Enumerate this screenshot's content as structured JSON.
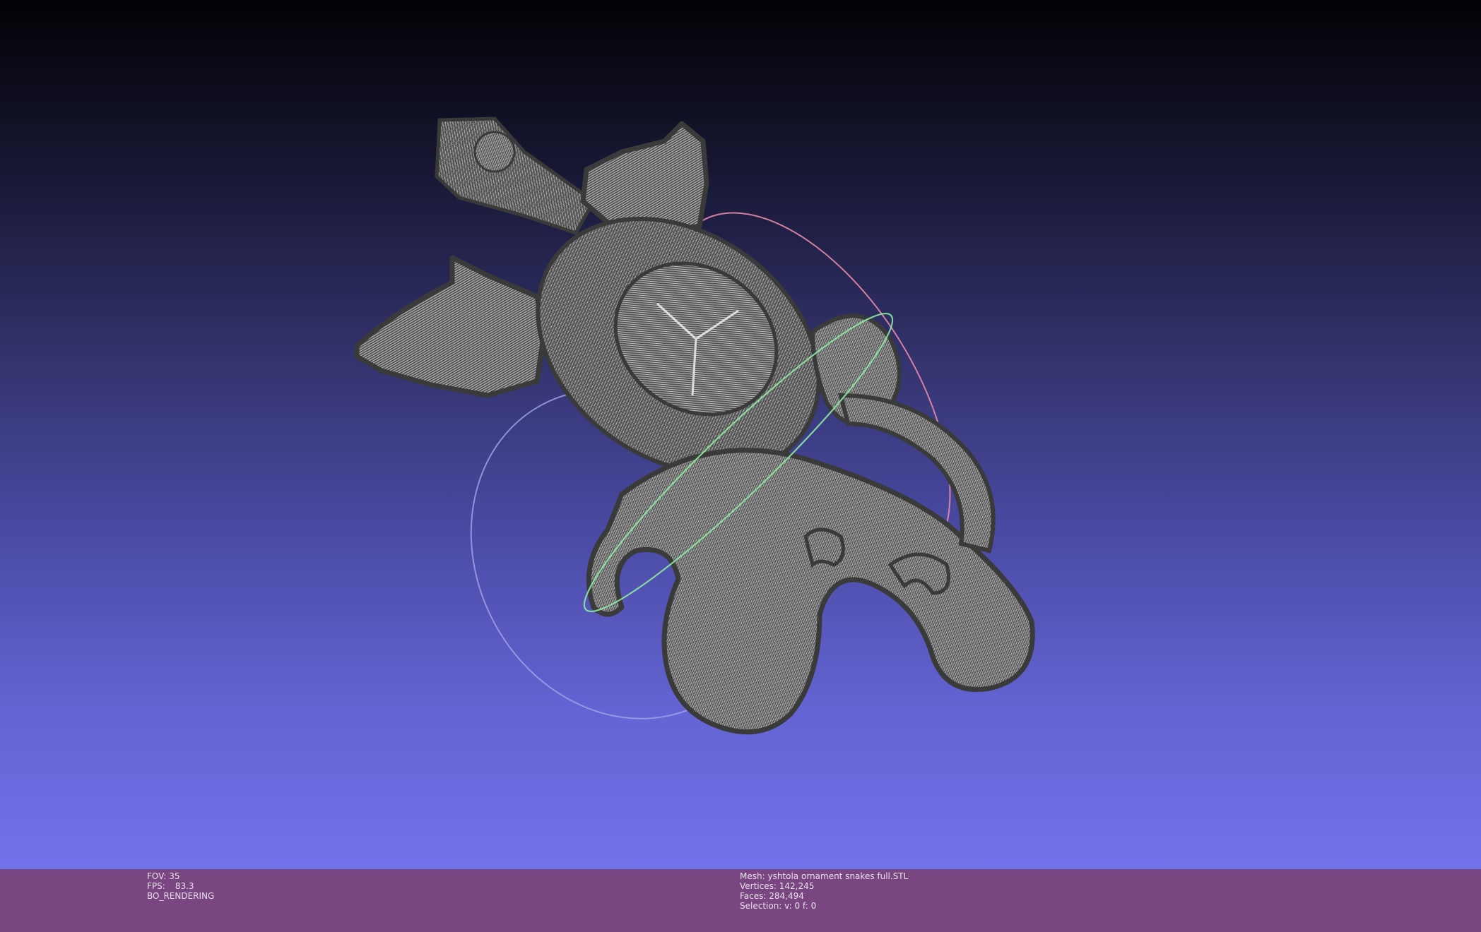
{
  "viewport": {
    "background_top": "#020205",
    "background_bottom": "#7272ea",
    "mesh_color": "#4a4a4a",
    "wire_color": "#d8d8d8",
    "trackball": {
      "x_ring_color": "#e88aa8",
      "y_ring_color": "#8ce8a0",
      "z_ring_color": "#a0a0e8"
    }
  },
  "status_left": {
    "fov_label": "FOV:",
    "fov_value": "35",
    "fps_label": "FPS:",
    "fps_value": "83.3",
    "render_mode": "BO_RENDERING"
  },
  "status_right": {
    "mesh_label": "Mesh:",
    "mesh_name": "yshtola ornament snakes full.STL",
    "vertices_label": "Vertices:",
    "vertices_value": "142,245",
    "faces_label": "Faces:",
    "faces_value": "284,494",
    "selection_label": "Selection:",
    "selection_value": "v: 0 f: 0"
  },
  "info_bar_color": "#7a4681"
}
